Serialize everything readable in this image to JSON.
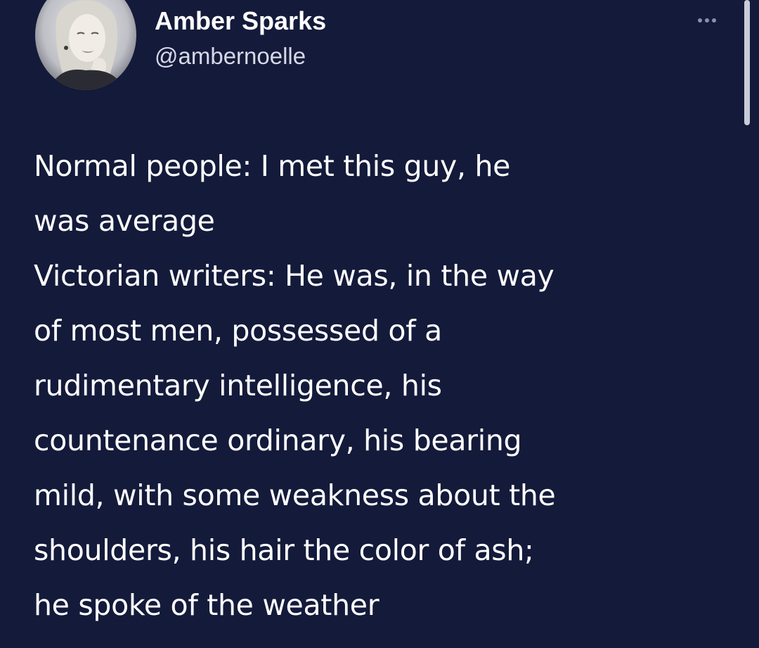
{
  "author": {
    "display_name": "Amber Sparks",
    "handle": "@ambernoelle",
    "avatar": "profile-photo"
  },
  "menu": {
    "icon": "more-horizontal-icon"
  },
  "tweet": {
    "lines": [
      "Normal people: I met this guy, he",
      "was average",
      "Victorian writers: He was, in the way",
      "of most men, possessed of a",
      "rudimentary intelligence, his",
      "countenance ordinary, his bearing",
      "mild, with some weakness about the",
      "shoulders, his hair the color of ash;",
      "he spoke of the weather"
    ]
  },
  "colors": {
    "background": "#141a3a",
    "text": "#ffffff",
    "handle": "#d6d9e6"
  }
}
